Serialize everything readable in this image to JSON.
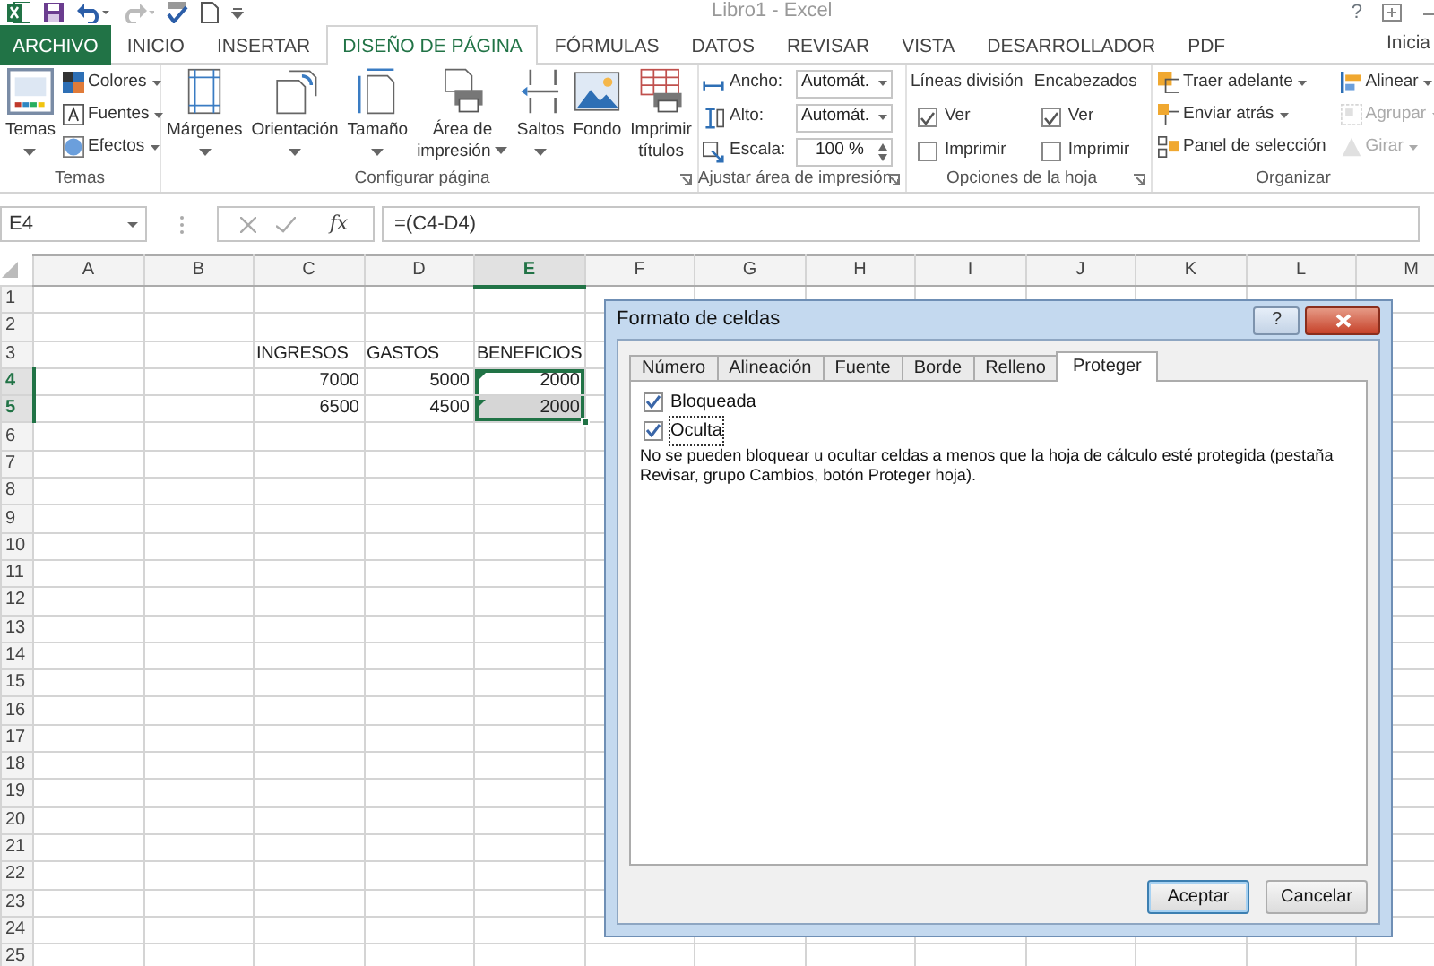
{
  "window": {
    "title": "Libro1 - Excel",
    "help": "?",
    "signin": "Inicia"
  },
  "ribbon_tabs": [
    {
      "label": "ARCHIVO",
      "kind": "file",
      "selected": false
    },
    {
      "label": "INICIO",
      "kind": "tab",
      "selected": false
    },
    {
      "label": "INSERTAR",
      "kind": "tab",
      "selected": false
    },
    {
      "label": "DISEÑO DE PÁGINA",
      "kind": "tab",
      "selected": true
    },
    {
      "label": "FÓRMULAS",
      "kind": "tab",
      "selected": false
    },
    {
      "label": "DATOS",
      "kind": "tab",
      "selected": false
    },
    {
      "label": "REVISAR",
      "kind": "tab",
      "selected": false
    },
    {
      "label": "VISTA",
      "kind": "tab",
      "selected": false
    },
    {
      "label": "DESARROLLADOR",
      "kind": "tab",
      "selected": false
    },
    {
      "label": "PDF",
      "kind": "tab",
      "selected": false
    }
  ],
  "ribbon_groups": [
    {
      "label": "Temas",
      "launcher": false,
      "columns": [
        [
          {
            "kind": "large",
            "lines": [
              "Temas"
            ],
            "dropdown": true
          }
        ],
        [
          {
            "kind": "small",
            "label": "Colores",
            "dropdown": true,
            "disabled": false
          },
          {
            "kind": "small",
            "label": "Fuentes",
            "dropdown": true,
            "disabled": false
          },
          {
            "kind": "small",
            "label": "Efectos",
            "dropdown": true,
            "disabled": false
          }
        ]
      ]
    },
    {
      "label": "Configurar página",
      "launcher": true,
      "columns": [
        [
          {
            "kind": "large",
            "lines": [
              "Márgenes"
            ],
            "dropdown": true
          }
        ],
        [
          {
            "kind": "large",
            "lines": [
              "Orientación"
            ],
            "dropdown": true
          }
        ],
        [
          {
            "kind": "large",
            "lines": [
              "Tamaño"
            ],
            "dropdown": true
          }
        ],
        [
          {
            "kind": "large",
            "lines": [
              "Área de",
              "impresión"
            ],
            "dropdown": true
          }
        ],
        [
          {
            "kind": "large",
            "lines": [
              "Saltos"
            ],
            "dropdown": true
          }
        ],
        [
          {
            "kind": "large",
            "lines": [
              "Fondo"
            ],
            "dropdown": false
          }
        ],
        [
          {
            "kind": "large",
            "lines": [
              "Imprimir",
              "títulos"
            ],
            "dropdown": false
          }
        ]
      ]
    },
    {
      "label": "Ajustar área de impresión",
      "launcher": true,
      "columns": [
        [
          {
            "kind": "dropdown_field",
            "label": "Ancho:",
            "value": "Automát."
          },
          {
            "kind": "dropdown_field",
            "label": "Alto:",
            "value": "Automát."
          },
          {
            "kind": "spin_field",
            "label": "Escala:",
            "value": "100 %"
          }
        ]
      ]
    },
    {
      "label": "Opciones de la hoja",
      "launcher": true,
      "columns": [
        [
          {
            "kind": "heading",
            "label": "Líneas división"
          },
          {
            "kind": "check",
            "label": "Ver",
            "checked": true
          },
          {
            "kind": "check",
            "label": "Imprimir",
            "checked": false
          }
        ],
        [
          {
            "kind": "heading",
            "label": "Encabezados"
          },
          {
            "kind": "check",
            "label": "Ver",
            "checked": true
          },
          {
            "kind": "check",
            "label": "Imprimir",
            "checked": false
          }
        ]
      ]
    },
    {
      "label": "Organizar",
      "launcher": false,
      "columns": [
        [
          {
            "kind": "small",
            "label": "Traer adelante",
            "dropdown": true,
            "disabled": false
          },
          {
            "kind": "small",
            "label": "Enviar atrás",
            "dropdown": true,
            "disabled": false
          },
          {
            "kind": "small",
            "label": "Panel de selección",
            "dropdown": false,
            "disabled": false
          }
        ],
        [
          {
            "kind": "small",
            "label": "Alinear",
            "dropdown": true,
            "disabled": false
          },
          {
            "kind": "small",
            "label": "Agrupar",
            "dropdown": true,
            "disabled": true
          },
          {
            "kind": "small",
            "label": "Girar",
            "dropdown": true,
            "disabled": true
          }
        ]
      ]
    }
  ],
  "formula_bar": {
    "name_box": "E4",
    "function_label": "fx",
    "formula": "=(C4-D4)"
  },
  "sheet": {
    "columns": [
      {
        "label": "A",
        "selected": false
      },
      {
        "label": "B",
        "selected": false
      },
      {
        "label": "C",
        "selected": false
      },
      {
        "label": "D",
        "selected": false
      },
      {
        "label": "E",
        "selected": true
      },
      {
        "label": "F",
        "selected": false
      },
      {
        "label": "G",
        "selected": false
      },
      {
        "label": "H",
        "selected": false
      },
      {
        "label": "I",
        "selected": false
      },
      {
        "label": "J",
        "selected": false
      },
      {
        "label": "K",
        "selected": false
      },
      {
        "label": "L",
        "selected": false
      },
      {
        "label": "M",
        "selected": false
      }
    ],
    "rows": [
      {
        "label": "1",
        "selected": false
      },
      {
        "label": "2",
        "selected": false
      },
      {
        "label": "3",
        "selected": false,
        "cells": [
          null,
          null,
          {
            "value": "INGRESOS",
            "kind": "text",
            "selected": false,
            "error_mark": false
          },
          {
            "value": "GASTOS",
            "kind": "text",
            "selected": false,
            "error_mark": false
          },
          {
            "value": "BENEFICIOS",
            "kind": "text",
            "selected": false,
            "error_mark": false
          }
        ]
      },
      {
        "label": "4",
        "selected": true,
        "cells": [
          null,
          null,
          {
            "value": "7000",
            "kind": "number",
            "selected": false,
            "error_mark": false
          },
          {
            "value": "5000",
            "kind": "number",
            "selected": false,
            "error_mark": false
          },
          {
            "value": "2000",
            "kind": "number",
            "selected": true,
            "active": true,
            "error_mark": true
          }
        ]
      },
      {
        "label": "5",
        "selected": true,
        "cells": [
          null,
          null,
          {
            "value": "6500",
            "kind": "number",
            "selected": false,
            "error_mark": false
          },
          {
            "value": "4500",
            "kind": "number",
            "selected": false,
            "error_mark": false
          },
          {
            "value": "2000",
            "kind": "number",
            "selected": true,
            "active": false,
            "error_mark": true
          }
        ]
      },
      {
        "label": "6",
        "selected": false
      },
      {
        "label": "7",
        "selected": false
      },
      {
        "label": "8",
        "selected": false
      },
      {
        "label": "9",
        "selected": false
      },
      {
        "label": "10",
        "selected": false
      },
      {
        "label": "11",
        "selected": false
      },
      {
        "label": "12",
        "selected": false
      },
      {
        "label": "13",
        "selected": false
      },
      {
        "label": "14",
        "selected": false
      },
      {
        "label": "15",
        "selected": false
      },
      {
        "label": "16",
        "selected": false
      },
      {
        "label": "17",
        "selected": false
      },
      {
        "label": "18",
        "selected": false
      },
      {
        "label": "19",
        "selected": false
      },
      {
        "label": "20",
        "selected": false
      },
      {
        "label": "21",
        "selected": false
      },
      {
        "label": "22",
        "selected": false
      },
      {
        "label": "23",
        "selected": false
      },
      {
        "label": "24",
        "selected": false
      },
      {
        "label": "25",
        "selected": false
      }
    ]
  },
  "dialog": {
    "title": "Formato de celdas",
    "help": "?",
    "tabs": [
      {
        "label": "Número",
        "selected": false
      },
      {
        "label": "Alineación",
        "selected": false
      },
      {
        "label": "Fuente",
        "selected": false
      },
      {
        "label": "Borde",
        "selected": false
      },
      {
        "label": "Relleno",
        "selected": false
      },
      {
        "label": "Proteger",
        "selected": true
      }
    ],
    "checkboxes": [
      {
        "label": "Bloqueada",
        "checked": true,
        "focused": false
      },
      {
        "label": "Oculta",
        "checked": true,
        "focused": true
      }
    ],
    "note": "No se pueden bloquear u ocultar celdas a menos que la hoja de cálculo esté protegida (pestaña Revisar, grupo Cambios, botón Proteger hoja).",
    "buttons": [
      {
        "label": "Aceptar",
        "default": true
      },
      {
        "label": "Cancelar",
        "default": false
      }
    ]
  }
}
